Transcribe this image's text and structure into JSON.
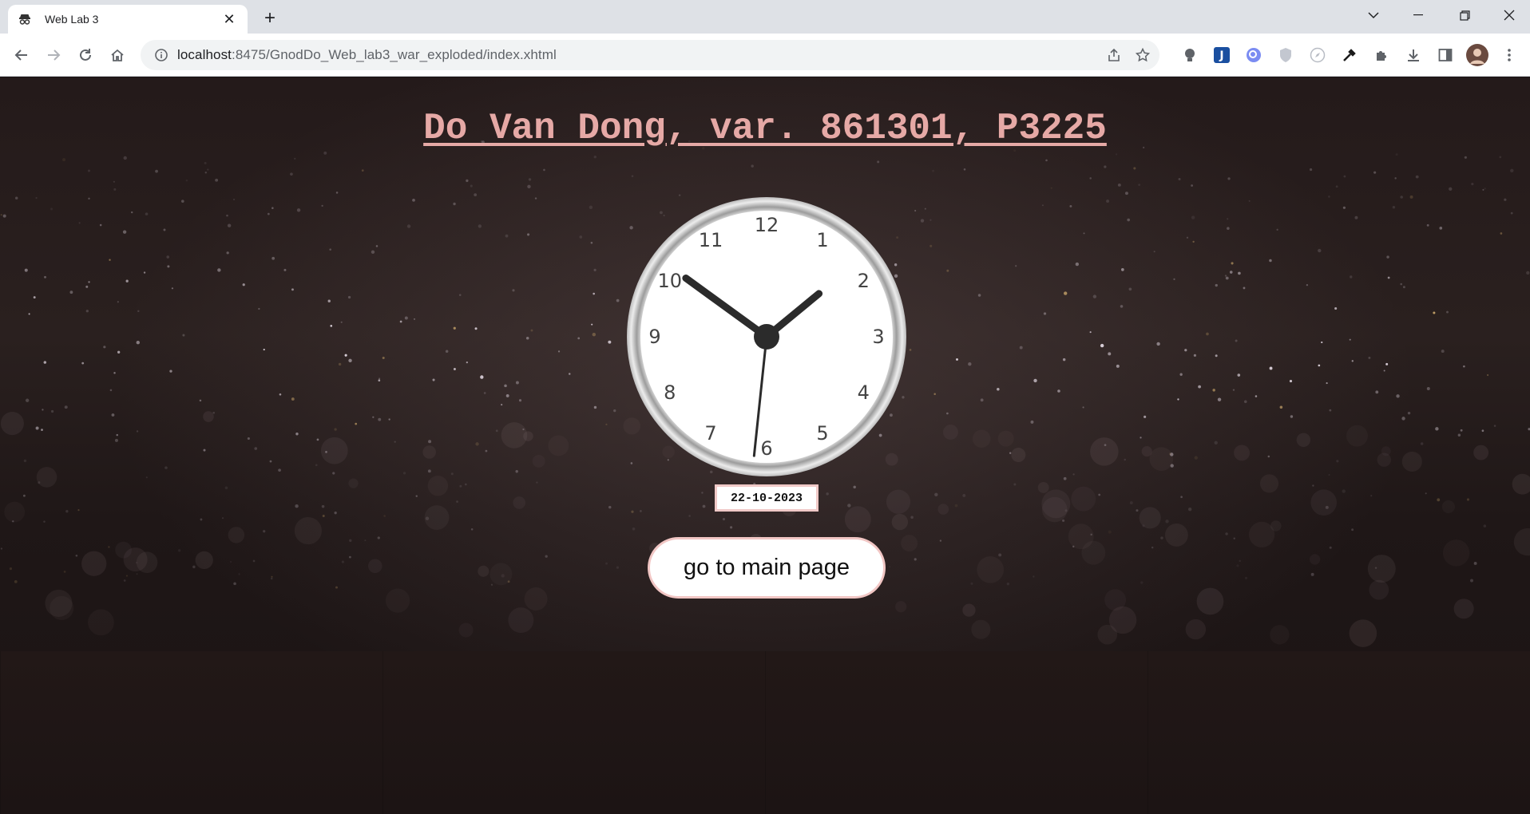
{
  "browser": {
    "tab_title": "Web Lab 3",
    "url_host": "localhost",
    "url_rest": ":8475/GnodDo_Web_lab3_war_exploded/index.xhtml",
    "icons": [
      "back-icon",
      "forward-icon",
      "reload-icon",
      "home-icon",
      "site-info-icon",
      "share-icon",
      "bookmark-star-icon",
      "extensions-icon",
      "download-icon",
      "side-panel-icon",
      "profile-avatar",
      "more-menu-icon"
    ]
  },
  "page": {
    "title": "Do Van Dong, var. 861301, P3225",
    "date": "22-10-2023",
    "main_button": "go to main page",
    "clock": {
      "numbers": [
        "12",
        "1",
        "2",
        "3",
        "4",
        "5",
        "6",
        "7",
        "8",
        "9",
        "10",
        "11"
      ],
      "hour": 1,
      "minute": 51,
      "second": 31
    }
  },
  "colors": {
    "title": "#e6a9a6",
    "button_border": "#f1c6c4",
    "background": "#1b1414"
  }
}
